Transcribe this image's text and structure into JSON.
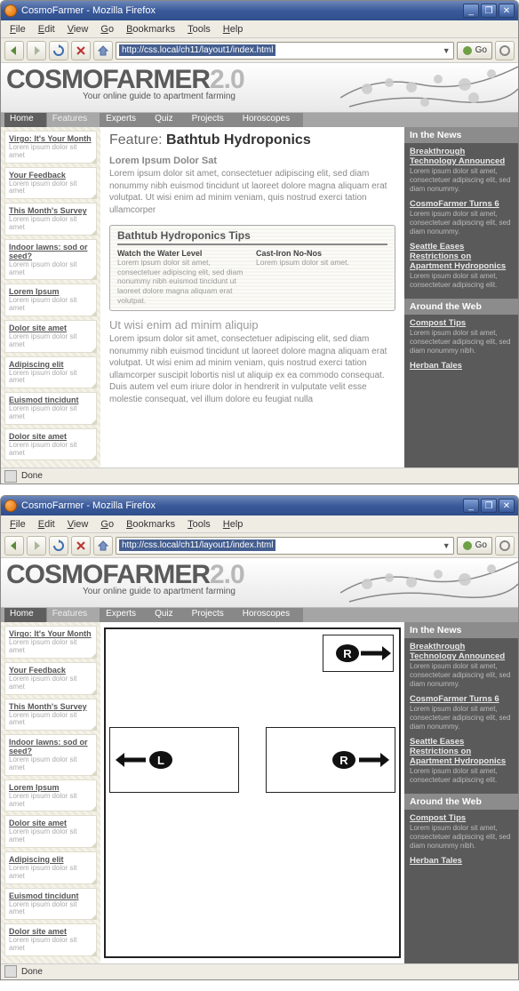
{
  "window": {
    "title": "CosmoFarmer - Mozilla Firefox",
    "min": "_",
    "max": "❐",
    "close": "✕"
  },
  "menu": {
    "file": "File",
    "edit": "Edit",
    "view": "View",
    "go": "Go",
    "bookmarks": "Bookmarks",
    "tools": "Tools",
    "help": "Help"
  },
  "toolbar": {
    "url": "http://css.local/ch11/layout1/index.html",
    "go": "Go"
  },
  "status": {
    "done": "Done"
  },
  "brand": {
    "name": "COSMOFARMER",
    "version": "2.0",
    "tagline": "Your online guide to apartment farming"
  },
  "nav": {
    "home": "Home",
    "features": "Features",
    "experts": "Experts",
    "quiz": "Quiz",
    "projects": "Projects",
    "horoscopes": "Horoscopes"
  },
  "sidebar": {
    "items": [
      {
        "title": "Virgo: It's Your Month",
        "body": "Lorem ipsum dolor sit amet"
      },
      {
        "title": "Your Feedback",
        "body": "Lorem ipsum dolor sit amet"
      },
      {
        "title": "This Month's Survey",
        "body": "Lorem ipsum dolor sit amet"
      },
      {
        "title": "Indoor lawns: sod or seed?",
        "body": "Lorem ipsum dolor sit amet"
      },
      {
        "title": "Lorem Ipsum",
        "body": "Lorem ipsum dolor sit amet"
      },
      {
        "title": "Dolor site amet",
        "body": "Lorem ipsum dolor sit amet"
      },
      {
        "title": "Adipiscing elit",
        "body": "Lorem ipsum dolor sit amet"
      },
      {
        "title": "Euismod tincidunt",
        "body": "Lorem ipsum dolor sit amet"
      },
      {
        "title": "Dolor site amet",
        "body": "Lorem ipsum dolor sit amet"
      }
    ]
  },
  "article": {
    "kicker": "Feature:",
    "title": "Bathtub Hydroponics",
    "sub1": "Lorem Ipsum Dolor Sat",
    "p1": "Lorem ipsum dolor sit amet, consectetuer adipiscing elit, sed diam nonummy nibh euismod tincidunt ut laoreet dolore magna aliquam erat volutpat. Ut wisi enim ad minim veniam, quis nostrud exerci tation ullamcorper",
    "tips": {
      "heading": "Bathtub Hydroponics Tips",
      "col1h": "Watch the Water Level",
      "col1p": "Lorem ipsum dolor sit amet, consectetuer adipiscing elit, sed diam nonummy nibh euismod tincidunt ut laoreet dolore magna aliquam erat volutpat.",
      "col2h": "Cast-Iron No-Nos",
      "col2p": "Lorem ipsum dolor sit amet."
    },
    "sub2": "Ut wisi enim ad minim aliquip",
    "p2": "Lorem ipsum dolor sit amet, consectetuer adipiscing elit, sed diam nonummy nibh euismod tincidunt ut laoreet dolore magna aliquam erat volutpat. Ut wisi enim ad minim veniam, quis nostrud exerci tation ullamcorper suscipit lobortis nisl ut aliquip ex ea commodo consequat. Duis autem vel eum iriure dolor in hendrerit in vulputate velit esse molestie consequat, vel illum dolore eu feugiat nulla"
  },
  "news": {
    "head1": "In the News",
    "items1": [
      {
        "link": "Breakthrough Technology Announced",
        "text": "Lorem ipsum dolor sit amet, consectetuer adipiscing elit, sed diam nonummy."
      },
      {
        "link": "CosmoFarmer Turns 6",
        "text": "Lorem ipsum dolor sit amet, consectetuer adipiscing elit, sed diam nonummy."
      },
      {
        "link": "Seattle Eases Restrictions on Apartment Hydroponics",
        "text": "Lorem ipsum dolor sit amet, consectetuer adipiscing elit."
      }
    ],
    "head2": "Around the Web",
    "items2": [
      {
        "link": "Compost Tips",
        "text": "Lorem ipsum dolor sit amet, consectetuer adipiscing elit, sed diam nonummy nibh."
      },
      {
        "link": "Herban Tales",
        "text": ""
      }
    ]
  },
  "diagram": {
    "R": "R",
    "L": "L"
  }
}
